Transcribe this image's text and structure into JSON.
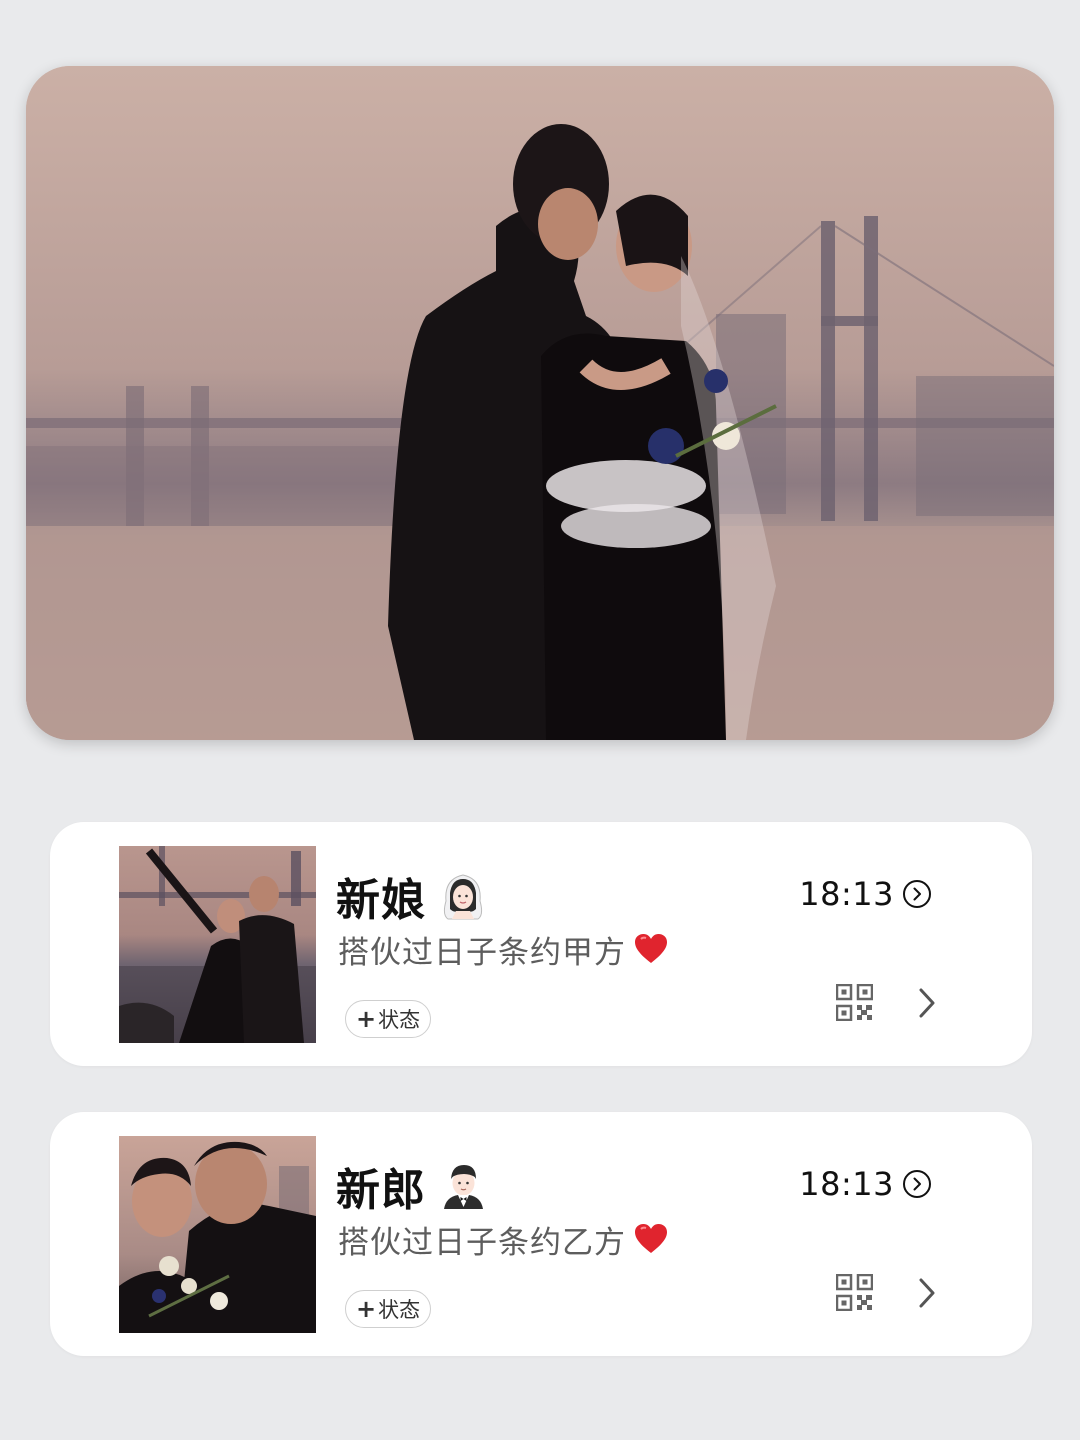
{
  "hero": {
    "image": "wedding-couple-riverside-photo"
  },
  "contacts": [
    {
      "name": "新娘",
      "emoji": "bride-with-veil-emoji",
      "subtitle": "搭伙过日子条约甲方",
      "subtitle_emoji": "red-heart-emoji",
      "time": "18:13",
      "status_label": "状态",
      "status_prefix": "+"
    },
    {
      "name": "新郎",
      "emoji": "groom-in-tuxedo-emoji",
      "subtitle": "搭伙过日子条约乙方",
      "subtitle_emoji": "red-heart-emoji",
      "time": "18:13",
      "status_label": "状态",
      "status_prefix": "+"
    }
  ],
  "colors": {
    "background": "#e9eaec",
    "card": "#ffffff",
    "heart": "#e0242e"
  }
}
